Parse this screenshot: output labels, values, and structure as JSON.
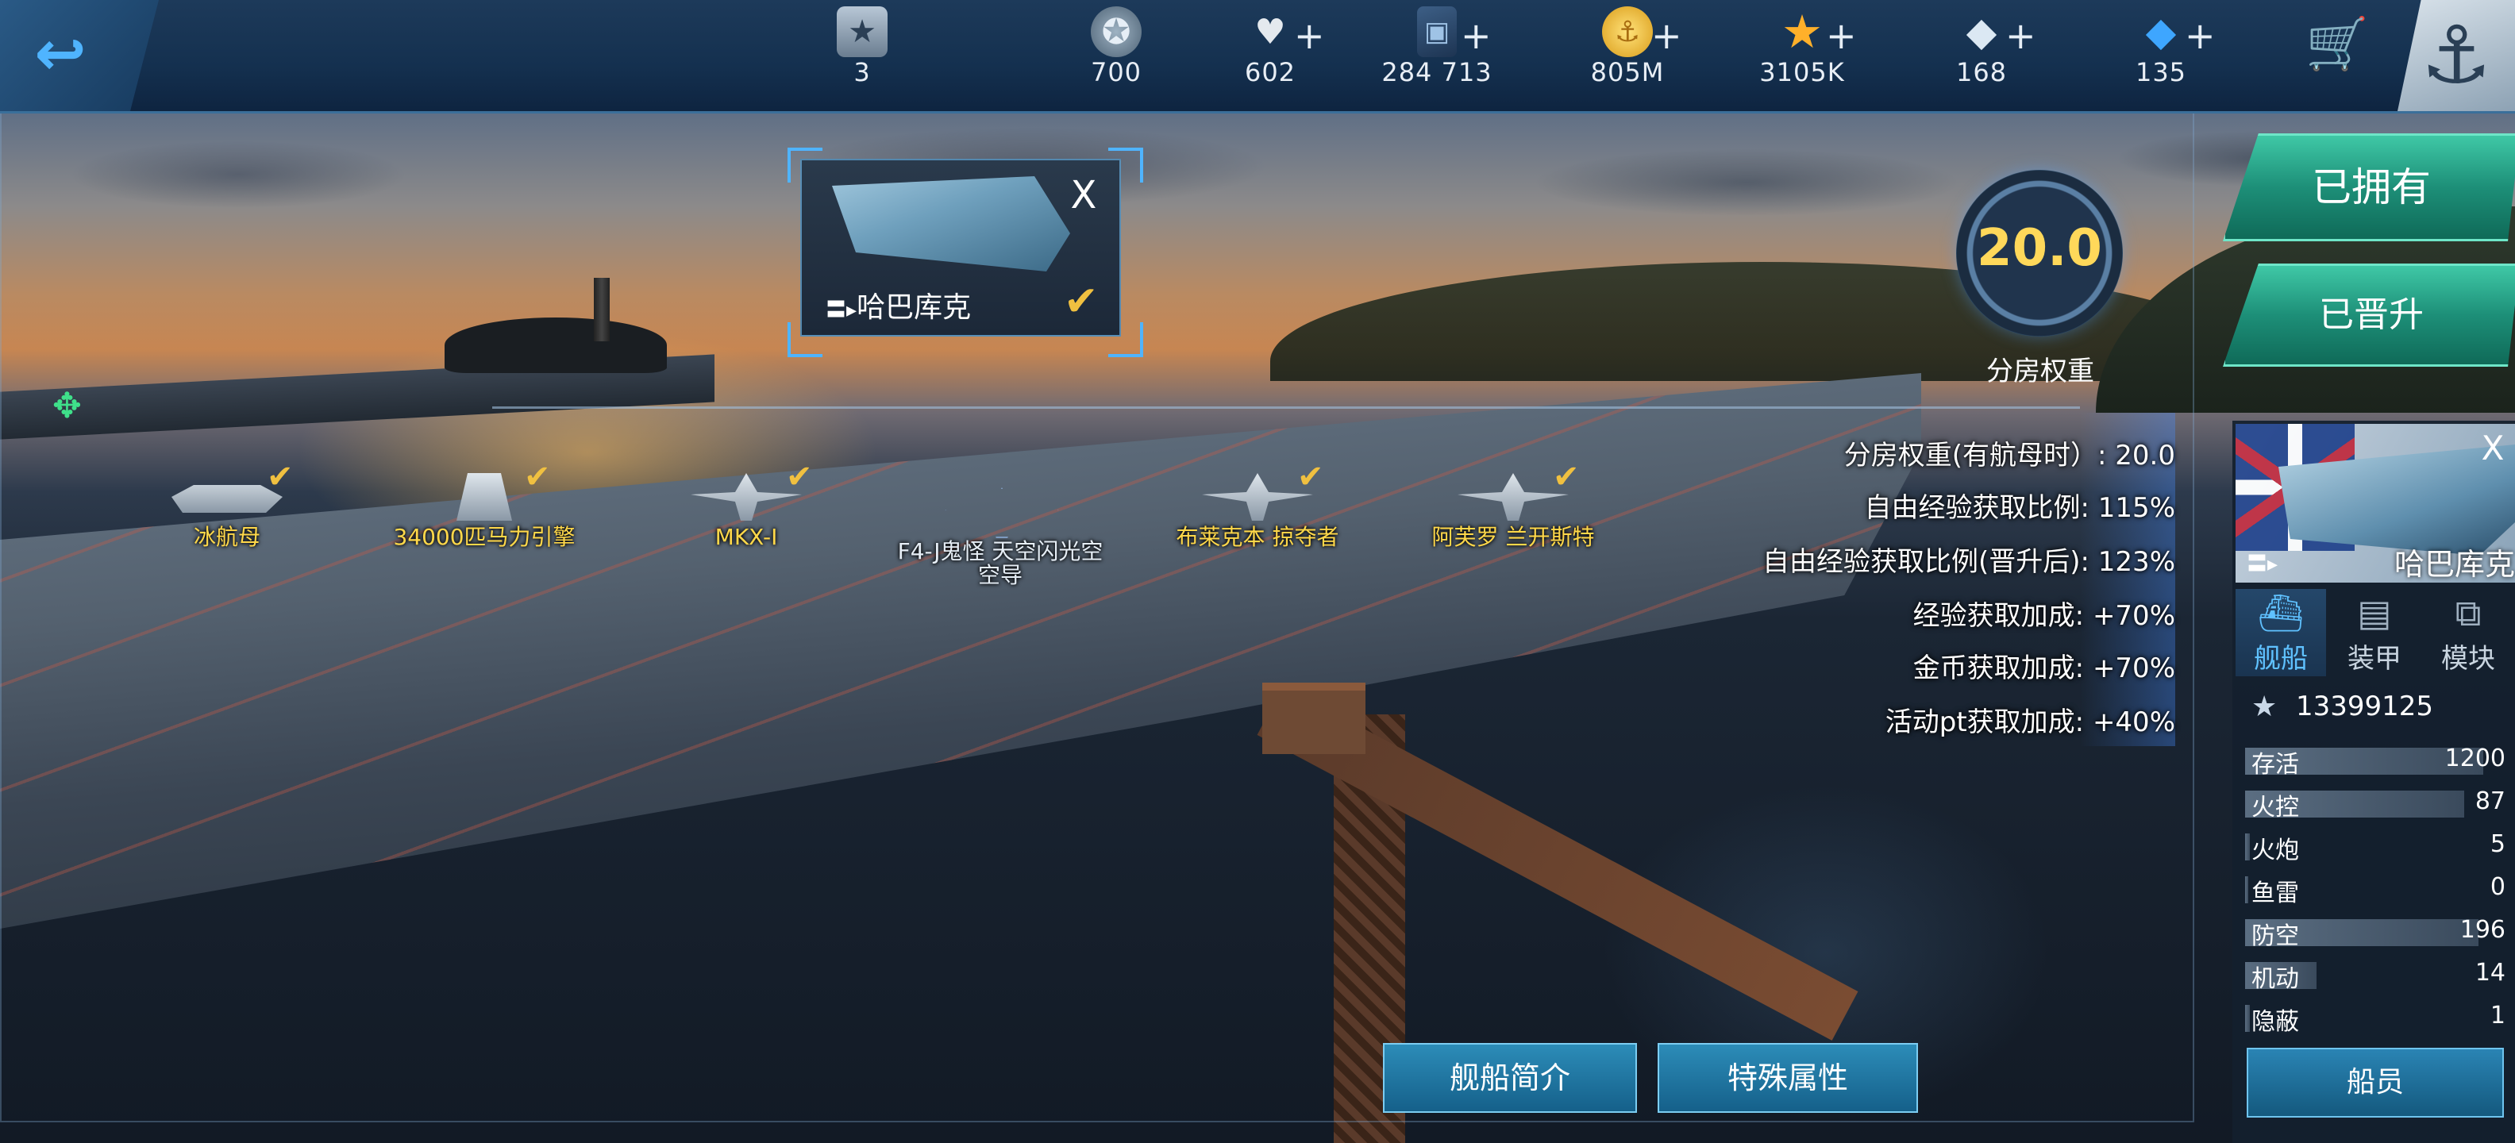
{
  "resources": [
    {
      "icon": "rank-badge-icon",
      "value": "3",
      "plus": false
    },
    {
      "icon": "medal-icon",
      "value": "700",
      "plus": false
    },
    {
      "icon": "heart-icon",
      "value": "602",
      "plus": true
    },
    {
      "icon": "card-icon",
      "value": "284 713",
      "plus": true
    },
    {
      "icon": "gold-coin-icon",
      "value": "805M",
      "plus": true
    },
    {
      "icon": "star-icon",
      "value": "3105K",
      "plus": true
    },
    {
      "icon": "diamond-icon",
      "value": "168",
      "plus": true
    },
    {
      "icon": "blue-crystal-icon",
      "value": "135",
      "plus": true
    }
  ],
  "selection": {
    "name": "哈巴库克",
    "close": "X"
  },
  "weight": {
    "value": "20.0",
    "caption": "分房权重"
  },
  "stats": [
    {
      "label": "分房权重(有航母时）:",
      "value": "20.0"
    },
    {
      "label": "自由经验获取比例:",
      "value": "115%"
    },
    {
      "label": "自由经验获取比例(晋升后):",
      "value": "123%"
    },
    {
      "label": "经验获取加成:",
      "value": "+70%"
    },
    {
      "label": "金币获取加成:",
      "value": "+70%"
    },
    {
      "label": "活动pt获取加成:",
      "value": "+40%"
    }
  ],
  "right_panel": {
    "owned_button": "已拥有",
    "promoted_button": "已晋升",
    "ship_name": "哈巴库克",
    "close": "X",
    "tabs": [
      {
        "label": "舰船",
        "icon": "ship-icon"
      },
      {
        "label": "装甲",
        "icon": "armor-icon"
      },
      {
        "label": "模块",
        "icon": "module-icon"
      }
    ],
    "score": "13399125",
    "attributes": [
      {
        "label": "存活",
        "value": "1200",
        "level": 1.0
      },
      {
        "label": "火控",
        "value": "87",
        "level": 0.92
      },
      {
        "label": "火炮",
        "value": "5",
        "level": 0.02
      },
      {
        "label": "鱼雷",
        "value": "0",
        "level": 0.0
      },
      {
        "label": "防空",
        "value": "196",
        "level": 0.98
      },
      {
        "label": "机动",
        "value": "14",
        "level": 0.3
      },
      {
        "label": "隐蔽",
        "value": "1",
        "level": 0.02
      }
    ],
    "crew_button": "船员"
  },
  "slots": [
    {
      "name": "冰航母",
      "checked": true,
      "empty": false
    },
    {
      "name": "34000匹马力引擎",
      "checked": true,
      "empty": false
    },
    {
      "name": "MKX-I",
      "checked": true,
      "empty": false
    },
    {
      "name": "F4-J鬼怪 天空闪光空空导",
      "checked": false,
      "empty": true
    },
    {
      "name": "布莱克本 掠夺者",
      "checked": true,
      "empty": false
    },
    {
      "name": "阿芙罗 兰开斯特",
      "checked": true,
      "empty": false
    }
  ],
  "bottom_buttons": {
    "intro": "舰船简介",
    "special": "特殊属性"
  }
}
